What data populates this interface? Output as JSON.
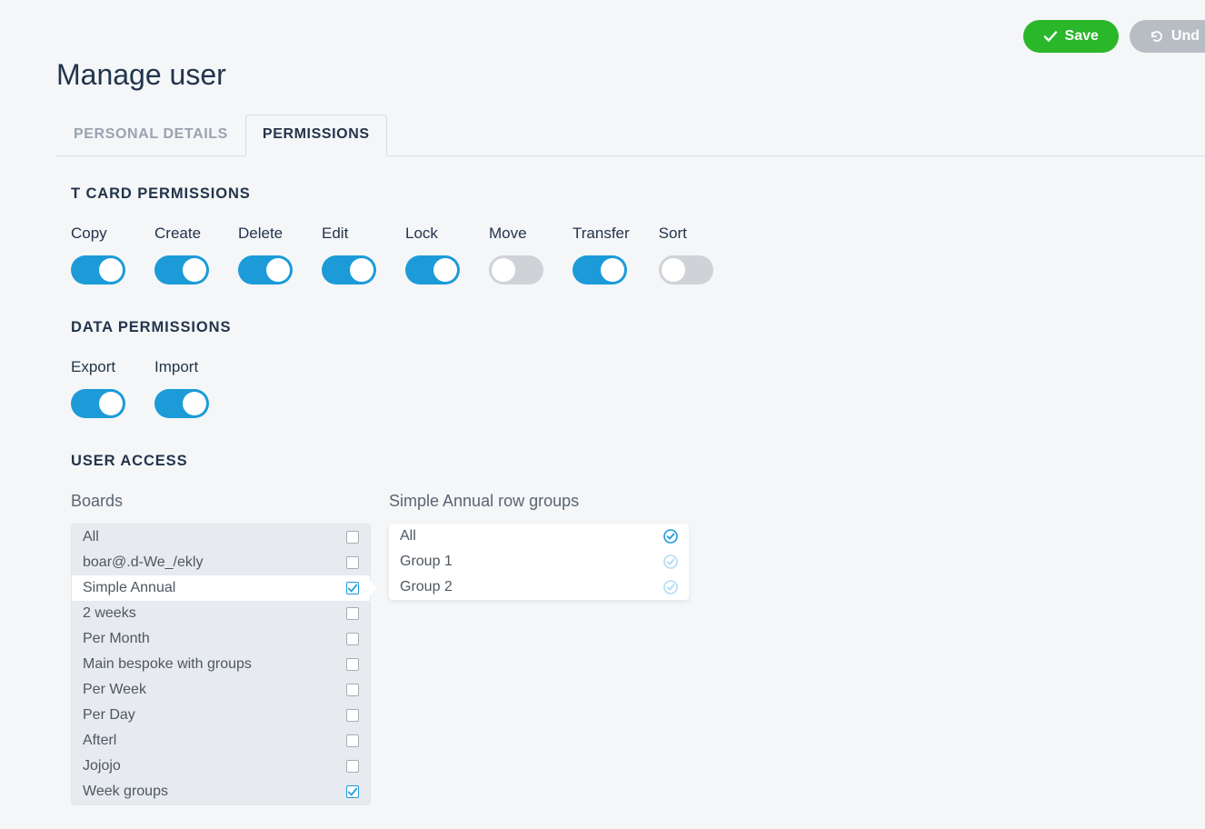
{
  "actions": {
    "save_label": "Save",
    "undo_label": "Und"
  },
  "page_title": "Manage user",
  "tabs": [
    {
      "label": "PERSONAL DETAILS",
      "active": false
    },
    {
      "label": "PERMISSIONS",
      "active": true
    }
  ],
  "sections": {
    "tcard_title": "T CARD PERMISSIONS",
    "data_title": "DATA PERMISSIONS",
    "access_title": "USER ACCESS"
  },
  "tcard_perms": [
    {
      "label": "Copy",
      "on": true
    },
    {
      "label": "Create",
      "on": true
    },
    {
      "label": "Delete",
      "on": true
    },
    {
      "label": "Edit",
      "on": true
    },
    {
      "label": "Lock",
      "on": true
    },
    {
      "label": "Move",
      "on": false
    },
    {
      "label": "Transfer",
      "on": true
    },
    {
      "label": "Sort",
      "on": false
    }
  ],
  "data_perms": [
    {
      "label": "Export",
      "on": true
    },
    {
      "label": "Import",
      "on": true
    }
  ],
  "boards": {
    "title": "Boards",
    "items": [
      {
        "label": "All",
        "checked": false,
        "selected": false
      },
      {
        "label": "boar@.d-We_/ekly",
        "checked": false,
        "selected": false
      },
      {
        "label": "Simple Annual",
        "checked": true,
        "selected": true
      },
      {
        "label": "2 weeks",
        "checked": false,
        "selected": false
      },
      {
        "label": "Per Month",
        "checked": false,
        "selected": false
      },
      {
        "label": "Main bespoke with groups",
        "checked": false,
        "selected": false
      },
      {
        "label": "Per Week",
        "checked": false,
        "selected": false
      },
      {
        "label": "Per Day",
        "checked": false,
        "selected": false
      },
      {
        "label": "Afterl",
        "checked": false,
        "selected": false
      },
      {
        "label": "Jojojo",
        "checked": false,
        "selected": false
      },
      {
        "label": "Week groups",
        "checked": true,
        "selected": false
      }
    ]
  },
  "row_groups": {
    "title": "Simple Annual row groups",
    "items": [
      {
        "label": "All",
        "state": "checked"
      },
      {
        "label": "Group 1",
        "state": "partial"
      },
      {
        "label": "Group 2",
        "state": "partial"
      }
    ]
  },
  "colors": {
    "accent": "#1c9bd8",
    "save": "#2ab72a"
  }
}
